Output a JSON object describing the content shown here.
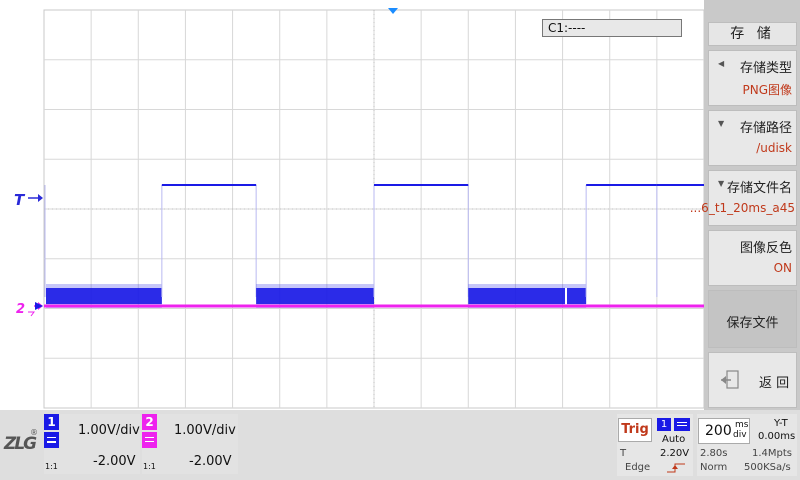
{
  "cursor_readout": "C1:----",
  "trigger_label": "T",
  "ch2_marker": "2",
  "save_menu": {
    "title": "存 储",
    "items": [
      {
        "label": "存储类型",
        "value": "PNG图像"
      },
      {
        "label": "存储路径",
        "value": "/udisk"
      },
      {
        "label": "存储文件名",
        "value": "...6_t1_20ms_a45"
      },
      {
        "label": "图像反色",
        "value": "ON"
      },
      {
        "label": "保存文件"
      },
      {
        "label": "返 回"
      }
    ]
  },
  "channels": [
    {
      "number": "1",
      "volts_div": "1.00V/div",
      "offset": "-2.00V",
      "probe": "1:1",
      "color": "#1a1ae6"
    },
    {
      "number": "2",
      "volts_div": "1.00V/div",
      "offset": "-2.00V",
      "probe": "1:1",
      "color": "#ee22ee"
    }
  ],
  "trigger": {
    "title": "Trig",
    "source": "1",
    "mode": "Auto",
    "t_label": "T",
    "level": "2.20V",
    "type": "Edge"
  },
  "timebase": {
    "value": "200",
    "unit_top": "ms",
    "unit_bottom": "div",
    "mode": "Y-T",
    "position": "0.00ms",
    "record_time": "2.80s",
    "memory_depth": "1.4Mpts",
    "acq_mode": "Norm",
    "sample_rate": "500KSa/s"
  },
  "colors": {
    "ch1": "#1a1ae6",
    "ch2": "#ee22ee",
    "grid": "#d8d8d8",
    "value_text": "#c0391b",
    "trigger_label": "#2a2ad8"
  },
  "ch1_wave": {
    "high_segments_div": [
      [
        2.5,
        4.5
      ],
      [
        7.0,
        9.0
      ],
      [
        11.5,
        13.0
      ]
    ],
    "high_level_div": 2.5,
    "low_level_div": 0
  }
}
